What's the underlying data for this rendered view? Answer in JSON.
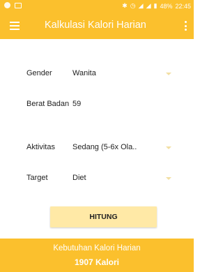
{
  "status_bar": {
    "time": "22:45",
    "battery": "48%"
  },
  "app_bar": {
    "title": "Kalkulasi Kalori Harian"
  },
  "form": {
    "gender": {
      "label": "Gender",
      "value": "Wanita"
    },
    "berat_badan": {
      "label": "Berat Badan",
      "value": "59"
    },
    "aktivitas": {
      "label": "Aktivitas",
      "value": "Sedang (5-6x Ola.."
    },
    "target": {
      "label": "Target",
      "value": "Diet"
    }
  },
  "button": {
    "label": "HITUNG"
  },
  "result": {
    "title": "Kebutuhan Kalori Harian",
    "value": "1907 Kalori"
  }
}
